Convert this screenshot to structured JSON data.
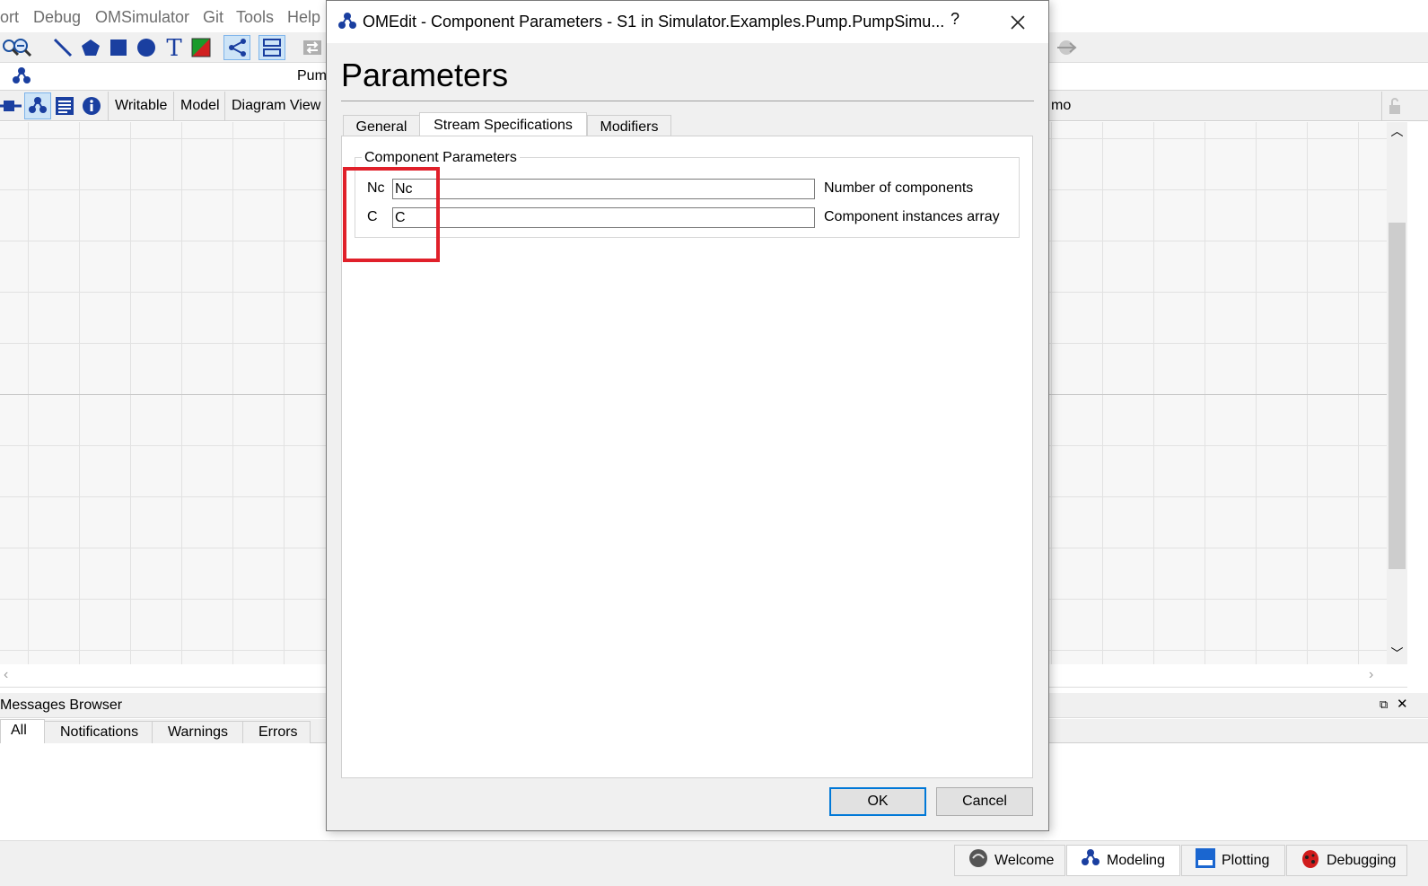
{
  "menu": [
    "ort",
    "Debug",
    "OMSimulator",
    "Git",
    "Tools",
    "Help"
  ],
  "background": {
    "model_title_partial": "Pum",
    "view_buttons": [
      "Writable",
      "Model",
      "Diagram View"
    ],
    "right_partial_label": "mo",
    "messages_browser_title": "Messages Browser",
    "message_tabs": [
      "All",
      "Notifications",
      "Warnings",
      "Errors"
    ],
    "perspectives": [
      "Welcome",
      "Modeling",
      "Plotting",
      "Debugging"
    ]
  },
  "dialog": {
    "title": "OMEdit - Component Parameters - S1 in Simulator.Examples.Pump.PumpSimu...",
    "help": "?",
    "heading": "Parameters",
    "tabs": [
      "General",
      "Stream Specifications",
      "Modifiers"
    ],
    "active_tab": "Stream Specifications",
    "group_title": "Component Parameters",
    "params": [
      {
        "label": "Nc",
        "value": "Nc",
        "description": "Number of components"
      },
      {
        "label": "C",
        "value": "C",
        "description": "Component instances array"
      }
    ],
    "ok": "OK",
    "cancel": "Cancel"
  },
  "colors": {
    "highlight": "#e0202a",
    "ok_border": "#0078d7"
  }
}
